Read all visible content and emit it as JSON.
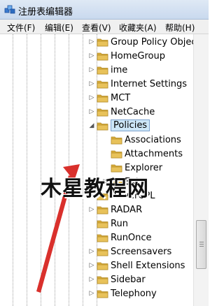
{
  "window": {
    "title": "注册表编辑器"
  },
  "menu": {
    "file": "文件(F)",
    "edit": "编辑(E)",
    "view": "查看(V)",
    "favorites": "收藏夹(A)",
    "help": "帮助(H)"
  },
  "tree": {
    "items": [
      {
        "label": "Group Policy Objec",
        "expander": "▷"
      },
      {
        "label": "HomeGroup",
        "expander": "▷"
      },
      {
        "label": "ime",
        "expander": "▷"
      },
      {
        "label": "Internet Settings",
        "expander": "▷"
      },
      {
        "label": "MCT",
        "expander": "▷"
      },
      {
        "label": "NetCache",
        "expander": "▷"
      },
      {
        "label": "Policies",
        "expander": "◢",
        "selected": true
      },
      {
        "label": "Associations",
        "expander": ""
      },
      {
        "label": "Attachments",
        "expander": ""
      },
      {
        "label": "Explorer",
        "expander": ""
      },
      {
        "label": "Ext",
        "expander": "▷"
      },
      {
        "label": "PowerCPL",
        "expander": "▷"
      },
      {
        "label": "RADAR",
        "expander": "▷"
      },
      {
        "label": "Run",
        "expander": ""
      },
      {
        "label": "RunOnce",
        "expander": ""
      },
      {
        "label": "Screensavers",
        "expander": "▷"
      },
      {
        "label": "Shell Extensions",
        "expander": "▷"
      },
      {
        "label": "Sidebar",
        "expander": "▷"
      },
      {
        "label": "Telephony",
        "expander": "▷"
      }
    ]
  },
  "watermark": {
    "text": "木星教程网"
  },
  "colors": {
    "folder": "#e8c25a",
    "selection": "#cde6f7",
    "accent_arrow": "#d9302c"
  },
  "icons": {
    "app": "registry-editor-icon",
    "folder": "folder-icon",
    "expand": "expand-arrow-icon",
    "collapse": "collapse-arrow-icon"
  }
}
